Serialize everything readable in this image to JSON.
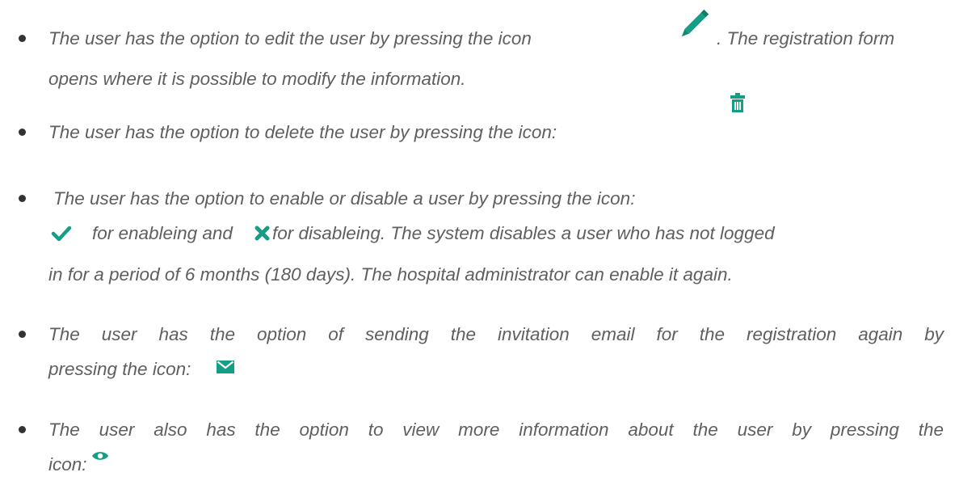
{
  "items": [
    {
      "lines": [
        "The user has the option to edit the user by pressing the icon",
        ". The registration form",
        "opens where it is possible to modify the information."
      ],
      "icon": "pencil-icon"
    },
    {
      "lines": [
        "The user has the option to delete the user by pressing the icon:"
      ],
      "icon": "trash-icon"
    },
    {
      "lines": [
        "The user has the option to enable or disable a user by pressing the icon:",
        "for enableing and",
        "for disableing. The system disables a user who has not logged",
        "in for a period of 6 months (180 days). The hospital administrator can enable it again."
      ],
      "icons": [
        "check-icon",
        "x-icon"
      ]
    },
    {
      "lines": [
        "The user has the option of sending the invitation email for the registration again by",
        "pressing the icon:"
      ],
      "icon": "envelope-icon"
    },
    {
      "lines": [
        "The user also has the option to view more information about the user by pressing the",
        "icon:"
      ],
      "icon": "eye-icon"
    }
  ],
  "colors": {
    "text": "#5f5f5f",
    "bullet": "#333333",
    "icon_teal": "#149e87"
  }
}
